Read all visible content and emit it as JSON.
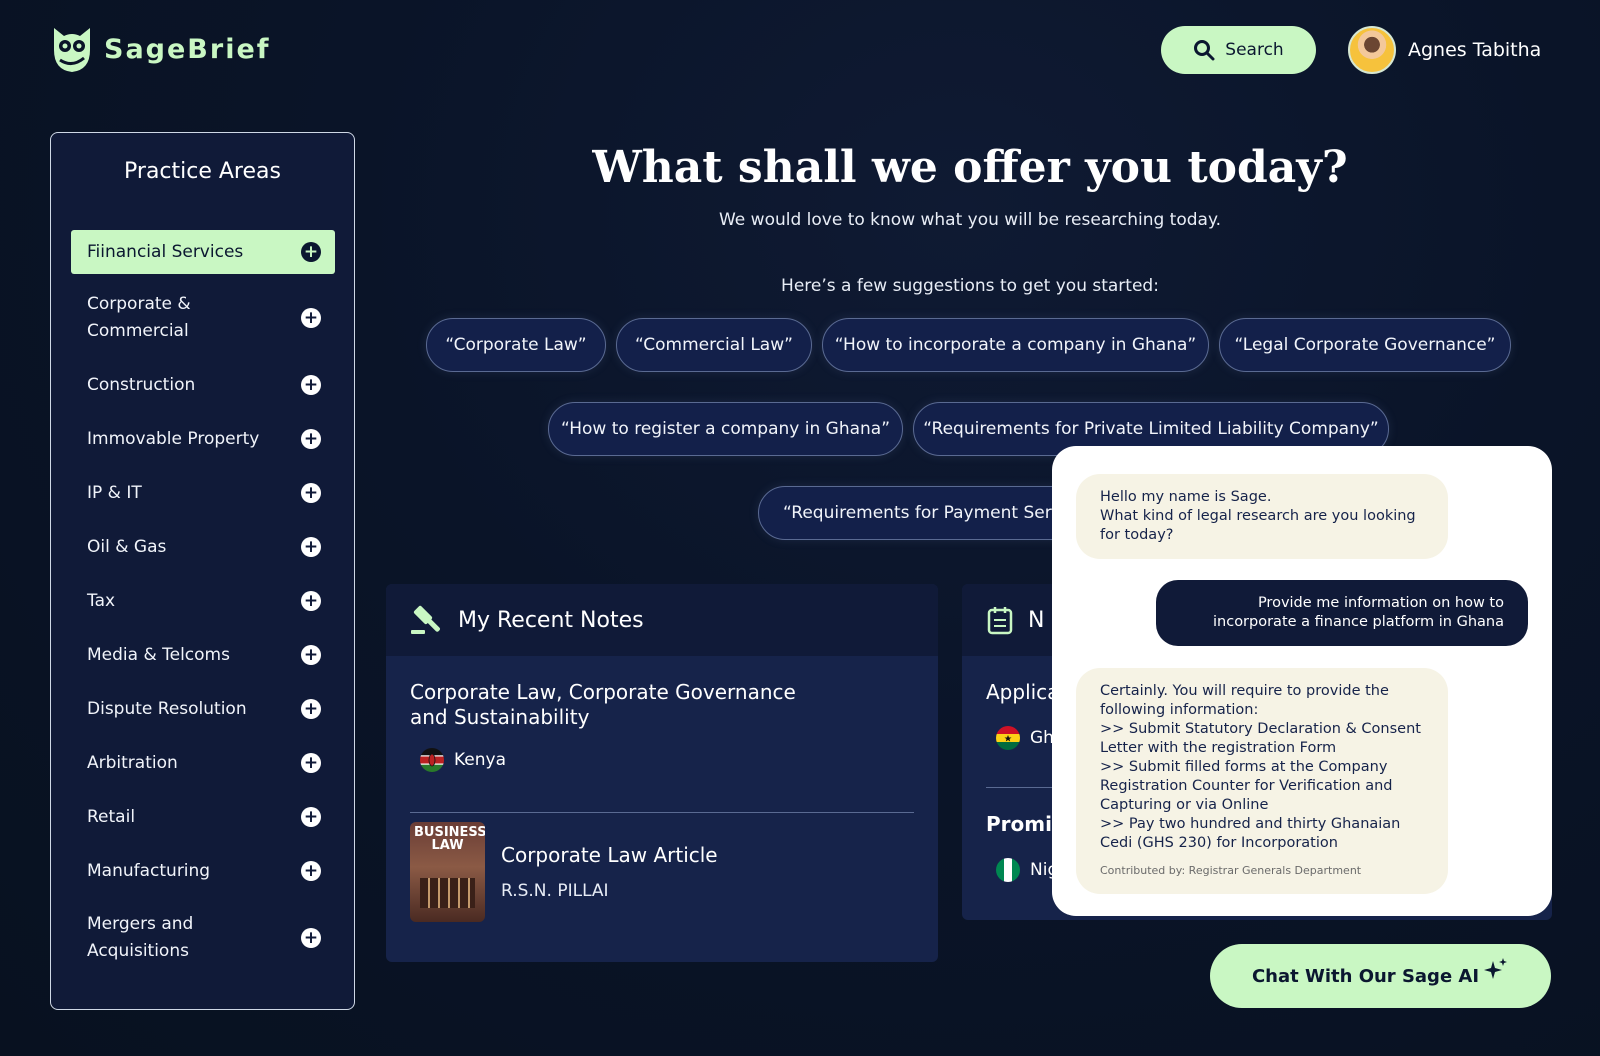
{
  "brand": {
    "name": "SageBrief"
  },
  "header": {
    "search_label": "Search",
    "user_name": "Agnes Tabitha"
  },
  "sidebar": {
    "title": "Practice Areas",
    "items": [
      {
        "label": "Fiinancial Services"
      },
      {
        "label": "Corporate & Commercial"
      },
      {
        "label": "Construction"
      },
      {
        "label": "Immovable Property"
      },
      {
        "label": "IP & IT"
      },
      {
        "label": "Oil & Gas"
      },
      {
        "label": "Tax"
      },
      {
        "label": "Media & Telcoms"
      },
      {
        "label": "Dispute Resolution"
      },
      {
        "label": "Arbitration"
      },
      {
        "label": "Retail"
      },
      {
        "label": "Manufacturing"
      },
      {
        "label": "Mergers and Acquisitions"
      }
    ]
  },
  "hero": {
    "title": "What shall we offer you today?",
    "subtitle": "We would love to know what you will be researching today.",
    "suggestions_intro": "Here’s a few suggestions to get you started:",
    "suggestions": [
      "“Corporate Law”",
      "“Commercial Law”",
      "“How to incorporate a company in Ghana”",
      "“Legal Corporate Governance”",
      "“How to register a company in Ghana”",
      "“Requirements for Private Limited Liability Company”",
      "“Requirements for Payment Servi"
    ]
  },
  "recent_notes": {
    "title": "My Recent Notes",
    "note_title": "Corporate Law, Corporate Governance and Sustainability",
    "country": "Kenya",
    "article_title": "Corporate Law Article",
    "article_author": "R.S.N. PILLAI",
    "book_cover_text": "BUSINESS LAW"
  },
  "second_card": {
    "title_partial": "N",
    "item1_partial": "Applica",
    "item1_country_partial": "Gh",
    "item2_partial": "Promiss",
    "item2_country_partial": "Nig"
  },
  "chat": {
    "bot_greeting_line1": "Hello my name is Sage.",
    "bot_greeting_line2": "What kind of legal research are you looking for today?",
    "user_message": "Provide me information on how to incorporate a finance platform in Ghana",
    "bot_reply": [
      "Certainly. You will require to provide the following information:",
      ">> Submit Statutory Declaration & Consent Letter with the registration Form",
      ">> Submit filled forms at the Company Registration Counter for Verification and Capturing or via Online",
      ">> Pay two hundred and thirty Ghanaian Cedi (GHS 230) for Incorporation"
    ],
    "contributed_by": "Contributed by: Registrar Generals Department",
    "button_label": "Chat With Our Sage AI"
  },
  "colors": {
    "accent": "#c9f7c3",
    "background": "#0a1428",
    "panel": "#16234a"
  },
  "icons": [
    "owl-logo-icon",
    "search-icon",
    "plus-circle-icon",
    "gavel-icon",
    "notepad-icon",
    "sparkle-icon"
  ]
}
